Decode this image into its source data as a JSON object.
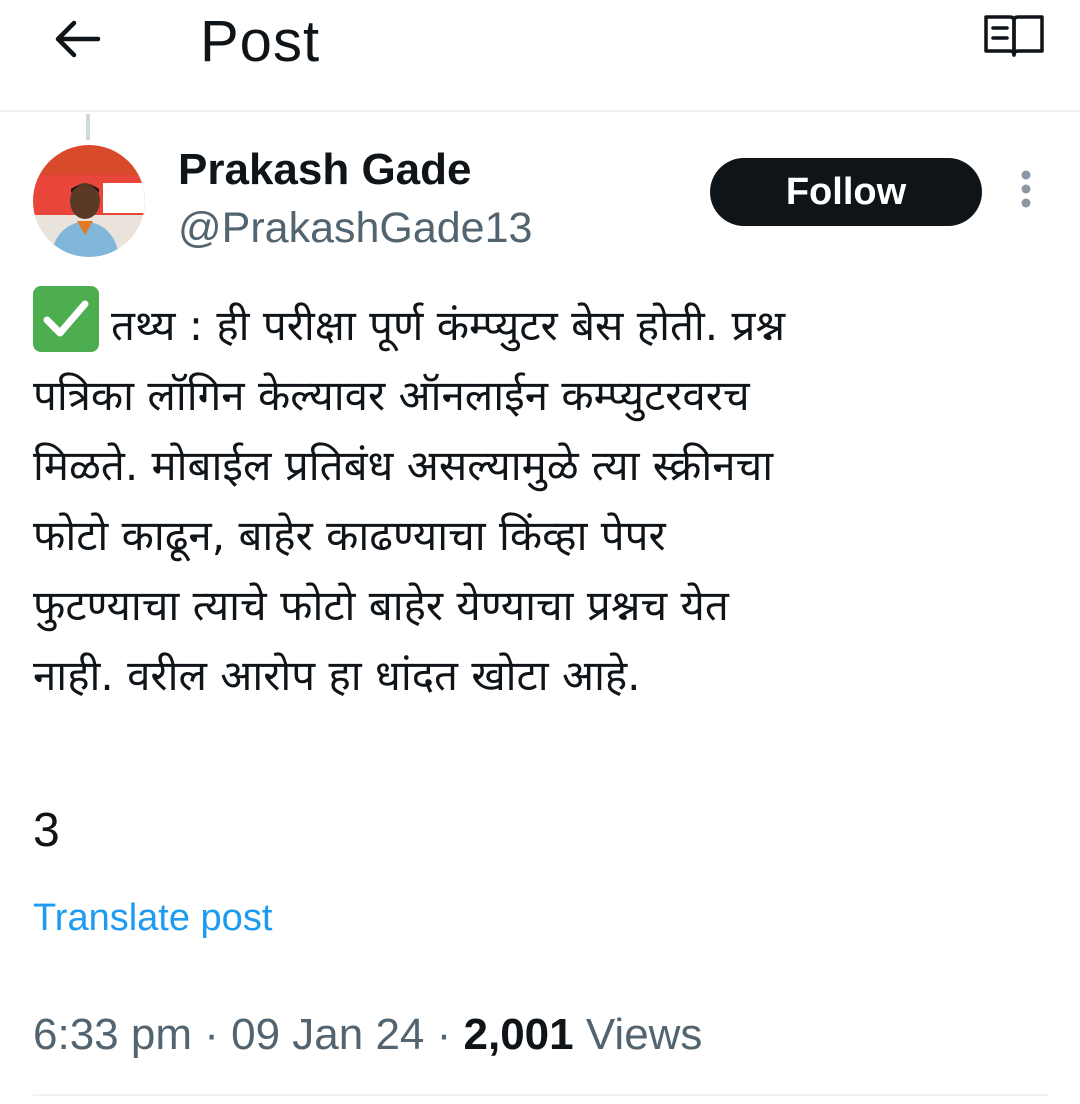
{
  "header": {
    "back_icon": "arrow-left-icon",
    "title": "Post",
    "reader_icon": "reader-mode-icon"
  },
  "author": {
    "display_name": "Prakash Gade",
    "handle": "@PrakashGade13",
    "avatar_icon": "profile-photo"
  },
  "actions": {
    "follow_label": "Follow",
    "more_icon": "more-vertical-icon"
  },
  "post": {
    "emoji": "check-mark-button-emoji",
    "lines": [
      "तथ्य : ही परीक्षा पूर्ण कंम्प्युटर बेस होती. प्रश्न",
      "पत्रिका लॉगिन केल्यावर ऑनलाईन कम्प्युटरवरच",
      "मिळते. मोबाईल प्रतिबंध असल्यामुळे त्या स्क्रीनचा",
      "फोटो काढून, बाहेर काढण्याचा किंव्हा पेपर",
      "फुटण्याचा त्याचे फोटो बाहेर येण्याचा प्रश्नच येत",
      "नाही. वरील आरोप हा धांदत खोटा आहे."
    ],
    "number": "3",
    "translate_label": "Translate post"
  },
  "meta": {
    "time": "6:33 pm",
    "separator": "·",
    "date": "09 Jan 24",
    "views_count": "2,001",
    "views_label": "Views"
  },
  "colors": {
    "text_primary": "#0f1419",
    "text_secondary": "#536471",
    "link": "#1d9bf0",
    "follow_bg": "#0f1419",
    "divider": "#eff3f4",
    "check_green": "#4cae4f"
  }
}
